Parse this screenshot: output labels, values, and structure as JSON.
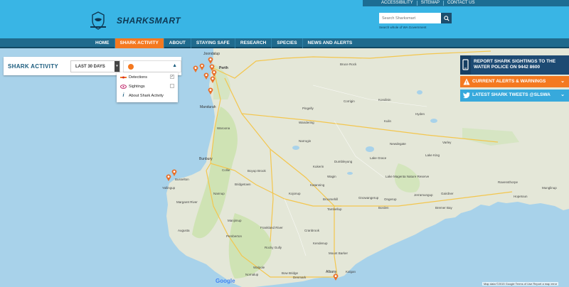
{
  "header": {
    "top_links": [
      "ACCESSIBILITY",
      "SITEMAP",
      "CONTACT US"
    ],
    "logo_text": "SHARKSMART",
    "search_placeholder": "Search Sharksmart",
    "search_sub": "Search whole of WA Government"
  },
  "nav": {
    "items": [
      "HOME",
      "SHARK ACTIVITY",
      "ABOUT",
      "STAYING SAFE",
      "RESEARCH",
      "SPECIES",
      "NEWS AND ALERTS"
    ],
    "active": "SHARK ACTIVITY"
  },
  "shark_activity": {
    "title": "SHARK ACTIVITY",
    "period": "LAST 30 DAYS",
    "filter_items": [
      {
        "label": "Detections",
        "checked": true,
        "icon": "detection-icon"
      },
      {
        "label": "Sightings",
        "checked": false,
        "icon": "eye-icon"
      },
      {
        "label": "About Shark Activity",
        "checked": null,
        "icon": "info-icon"
      }
    ]
  },
  "right_panels": {
    "report": "REPORT SHARK SIGHTINGS TO THE WATER POLICE ON 9442 8600",
    "alerts": "CURRENT ALERTS & WARNINGS",
    "tweets": "LATEST SHARK TWEETS @SLSWA"
  },
  "map": {
    "places": {
      "joondalup": "Joondalup",
      "perth": "Perth",
      "mandurah": "Mandurah",
      "bunbury": "Bunbury",
      "busselton": "Busselton",
      "yallingup": "Yallingup",
      "albany": "Albany",
      "kalgan": "Kalgan",
      "narrogin": "Narrogin",
      "katanning": "Katanning",
      "broomehill": "Broomehill",
      "kojonup": "Kojonup",
      "cranbrook": "Cranbrook",
      "mt_barker": "Mount Barker",
      "manjimup": "Manjimup",
      "bridgetown": "Bridgetown",
      "collie": "Collie",
      "dumbleyung": "Dumbleyung",
      "lake_grace": "Lake Grace",
      "newdegate": "Newdegate",
      "hyden": "Hyden",
      "kulin": "Kulin",
      "lake_magenta": "Lake Magenta Nature Reserve",
      "ravensthorpe": "Ravensthorpe",
      "kondinin": "Kondinin",
      "denmark": "Denmark",
      "walpole": "Walpole",
      "frankland_river": "Frankland River",
      "rocky_gully": "Rocky Gully",
      "boyup_brook": "Boyup Brook",
      "pemberton": "Pemberton",
      "nannup": "Nannup",
      "margaret_river": "Margaret River",
      "augusta": "Augusta",
      "bruce_rock": "Bruce Rock",
      "kondut": "Corrigin",
      "wandering": "Wandering",
      "jerramungup": "Jerramungup",
      "bremer_bay": "Bremer Bay",
      "gairdner": "Gairdner",
      "ongerup": "Ongerup",
      "gnowangerup": "Gnowangerup",
      "borden": "Borden",
      "tambellup": "Tambellup",
      "wagin": "Wagin",
      "pingelly": "Pingelly",
      "kukerin": "Kukerin",
      "lake_king": "Lake King",
      "varley": "Varley",
      "hopetoun": "Hopetoun",
      "munglinup": "Munglinup",
      "kendenup": "Kendenup",
      "bow_bridge": "Bow Bridge",
      "nornalup": "Nornalup",
      "mandurah_area": "Waroona"
    },
    "google": "Google",
    "attribution": "Map data ©2015 Google   Terms of Use   Report a map error"
  },
  "colors": {
    "brand": "#39b5e5",
    "nav": "#1f6a8d",
    "accent": "#f47920",
    "dark_blue": "#1d4a73",
    "tweet_blue": "#37a9dc"
  }
}
